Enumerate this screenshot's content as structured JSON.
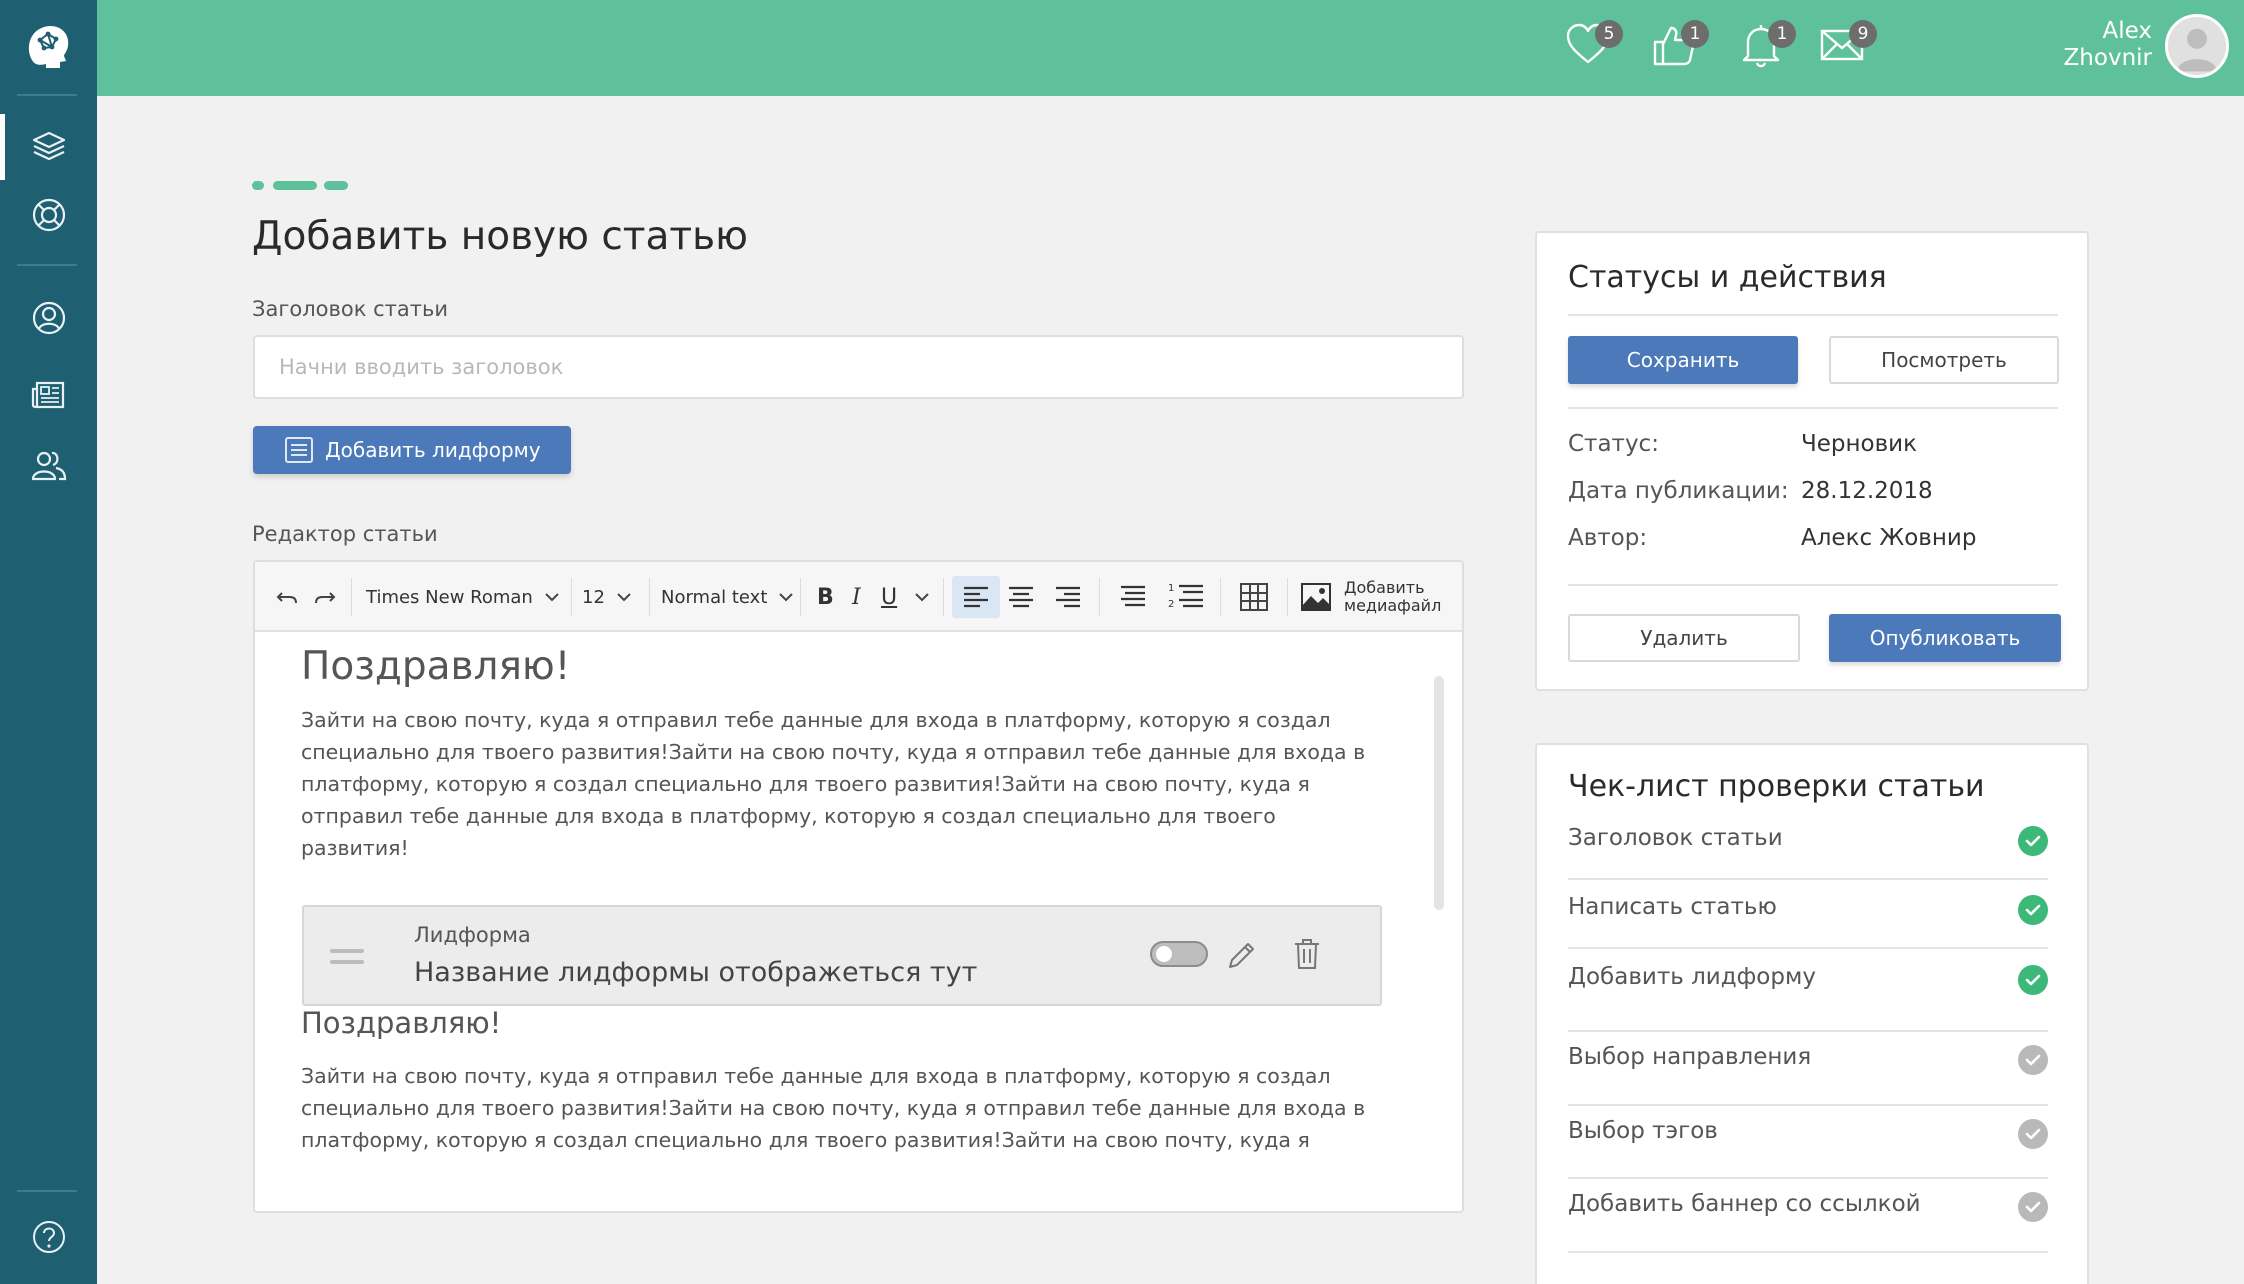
{
  "sidebar": {
    "logo_icon": "brain-head-icon",
    "items": [
      {
        "name": "courses",
        "icon": "stack-layers-icon"
      },
      {
        "name": "support",
        "icon": "lifebuoy-icon"
      },
      {
        "name": "profile",
        "icon": "user-icon"
      },
      {
        "name": "articles",
        "icon": "newspaper-icon"
      },
      {
        "name": "community",
        "icon": "users-icon"
      },
      {
        "name": "help",
        "icon": "question-circle-icon"
      }
    ]
  },
  "header": {
    "notifications": [
      {
        "icon": "heart-icon",
        "count": "5"
      },
      {
        "icon": "thumbs-up-icon",
        "count": "1"
      },
      {
        "icon": "bell-icon",
        "count": "1"
      },
      {
        "icon": "envelope-icon",
        "count": "9"
      }
    ],
    "user_first": "Alex",
    "user_last": "Zhovnir",
    "accent": "#5fc09c"
  },
  "main": {
    "page_title": "Добавить новую статью",
    "title_label": "Заголовок статьи",
    "title_placeholder": "Начни вводить заголовок",
    "add_leadform": "Добавить лидформу",
    "editor_label": "Редактор статьи"
  },
  "toolbar": {
    "font": "Times New Roman",
    "size": "12",
    "style": "Normal text",
    "bold": "B",
    "italic": "I",
    "underline": "U",
    "media_line1": "Добавить",
    "media_line2": "медиафайл"
  },
  "content": {
    "heading1": "Поздравляю!",
    "para1_l1": "Зайти на свою почту, куда я отправил тебе данные для входа в платформу, которую я создал",
    "para1_l2": "специально для твоего развития!Зайти на свою почту, куда я отправил тебе данные для входа в",
    "para1_l3": "платформу, которую я создал специально для твоего развития!Зайти на свою почту, куда я",
    "para1_l4": "отправил тебе данные для входа в платформу, которую я создал специально для твоего",
    "para1_l5": "развития!",
    "leadform_label": "Лидформа",
    "leadform_title": "Название лидформы отображеться тут",
    "heading2": "Поздравляю!",
    "para2_l1": "Зайти на свою почту, куда я отправил тебе данные для входа в платформу, которую я создал",
    "para2_l2": "специально для твоего развития!Зайти на свою почту, куда я отправил тебе данные для входа в",
    "para2_l3": "платформу, которую я создал специально для твоего развития!Зайти на свою почту, куда я"
  },
  "status_card": {
    "title": "Статусы и действия",
    "save": "Сохранить",
    "preview": "Посмотреть",
    "status_label": "Статус:",
    "status_value": "Черновик",
    "date_label": "Дата публикации:",
    "date_value": "28.12.2018",
    "author_label": "Автор:",
    "author_value": "Алекс Жовнир",
    "delete": "Удалить",
    "publish": "Опубликовать"
  },
  "checklist": {
    "title": "Чек-лист проверки статьи",
    "items": [
      {
        "label": "Заголовок статьи",
        "done": true
      },
      {
        "label": "Написать статью",
        "done": true
      },
      {
        "label": "Добавить лидформу",
        "done": true
      },
      {
        "label": "Выбор направления",
        "done": false
      },
      {
        "label": "Выбор тэгов",
        "done": false
      },
      {
        "label": "Добавить баннер со ссылкой",
        "done": false
      }
    ],
    "done_color": "#3cb878",
    "pending_color": "#b9b9b9"
  }
}
